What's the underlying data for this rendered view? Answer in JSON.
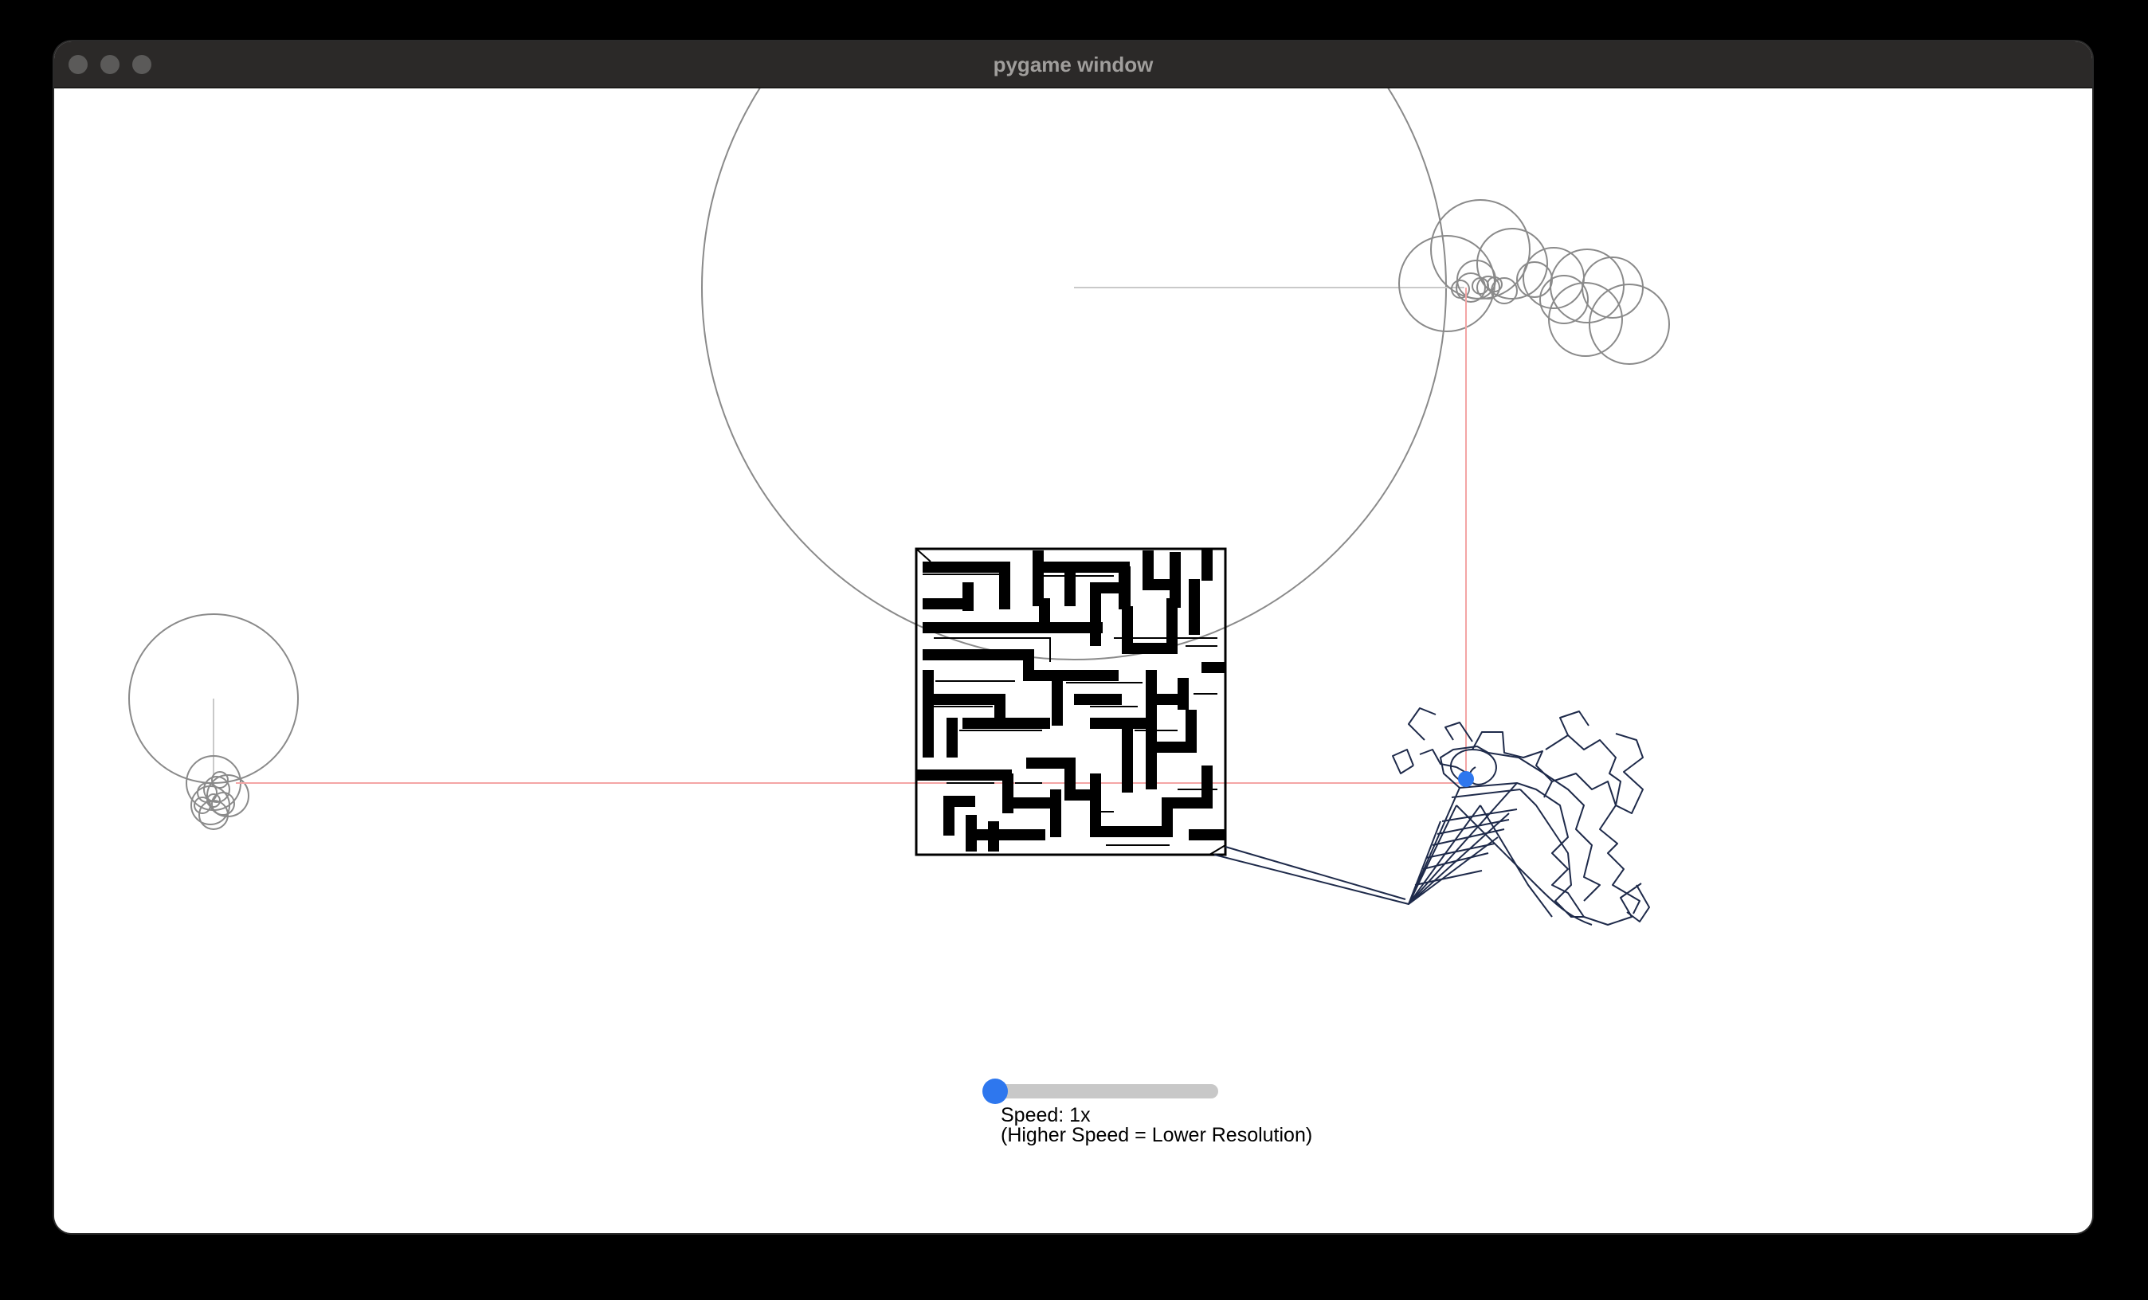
{
  "window": {
    "title": "pygame window"
  },
  "slider": {
    "speed_label": "Speed: 1x",
    "speed_note": "(Higher Speed = Lower Resolution)",
    "fill_fraction": 0.0,
    "knob_color": "#2e77ee",
    "track_color": "#c8c8c8"
  },
  "colors": {
    "epicycle": "#8a8a8a",
    "trace": "#1e2a4a",
    "guide_line": "#f4a5a5",
    "pen_dot": "#2e77ee",
    "maze": "#000000"
  },
  "icons": [
    "close-icon",
    "minimize-icon",
    "zoom-icon"
  ]
}
